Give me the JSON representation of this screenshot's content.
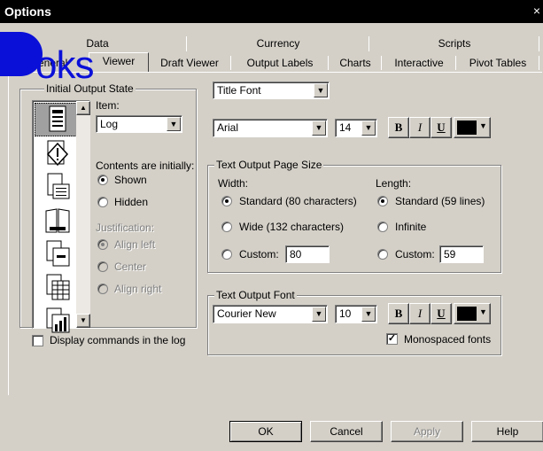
{
  "window": {
    "title": "Options",
    "close_glyph": "×"
  },
  "watermark": {
    "text": "oks"
  },
  "tabs_row1": [
    "Data",
    "Currency",
    "Scripts"
  ],
  "tabs_row2": [
    "General",
    "Viewer",
    "Draft Viewer",
    "Output Labels",
    "Charts",
    "Interactive",
    "Pivot Tables"
  ],
  "initial_output_state": {
    "group_label": "Initial Output State",
    "item_label": "Item:",
    "item_value": "Log",
    "contents_label": "Contents are initially:",
    "shown_label": "Shown",
    "hidden_label": "Hidden",
    "contents_selected": "Shown",
    "justification_label": "Justification:",
    "align_left_label": "Align left",
    "center_label": "Center",
    "align_right_label": "Align right",
    "icons": [
      "log-item-icon",
      "warning-item-icon",
      "notes-item-icon",
      "title-item-icon",
      "page-title-item-icon",
      "pivot-table-item-icon",
      "chart-item-icon"
    ]
  },
  "display_commands_label": "Display commands in the log",
  "display_commands_checked": false,
  "title_font": {
    "selector_value": "Title Font",
    "font_value": "Arial",
    "size_value": "14",
    "bold_label": "B",
    "italic_label": "I",
    "underline_label": "U",
    "color": "#000000"
  },
  "page_size": {
    "group_label": "Text Output Page Size",
    "width_label": "Width:",
    "width_standard": "Standard (80 characters)",
    "width_wide": "Wide (132 characters)",
    "width_custom": "Custom:",
    "width_custom_value": "80",
    "width_selected": "Standard (80 characters)",
    "length_label": "Length:",
    "length_standard": "Standard (59 lines)",
    "length_infinite": "Infinite",
    "length_custom": "Custom:",
    "length_custom_value": "59",
    "length_selected": "Standard (59 lines)"
  },
  "text_output_font": {
    "group_label": "Text Output Font",
    "font_value": "Courier New",
    "size_value": "10",
    "bold_label": "B",
    "italic_label": "I",
    "underline_label": "U",
    "color": "#000000",
    "monospaced_label": "Monospaced fonts",
    "monospaced_checked": true
  },
  "buttons": {
    "ok": "OK",
    "cancel": "Cancel",
    "apply": "Apply",
    "help": "Help"
  }
}
